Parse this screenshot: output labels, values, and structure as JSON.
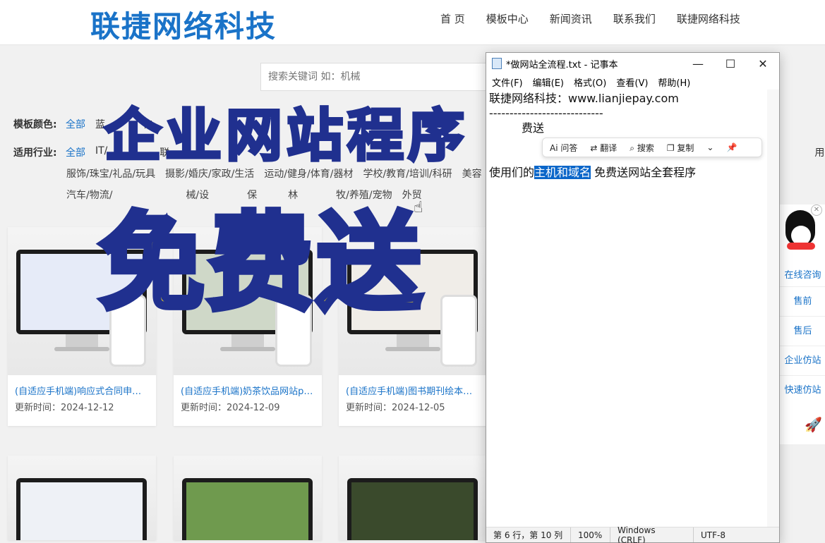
{
  "site": {
    "logo": "联捷网络科技",
    "nav": [
      "首 页",
      "模板中心",
      "新闻资讯",
      "联系我们",
      "联捷网络科技"
    ],
    "search_placeholder": "搜索关键词 如：机械"
  },
  "filters": {
    "color_label": "模板颜色:",
    "color_items": [
      "全部",
      "蓝",
      "白"
    ],
    "industry_label": "适用行业:",
    "industry_items": [
      "全部",
      "IT/",
      "联",
      "用"
    ],
    "row2": [
      "服饰/珠宝/礼品/玩具",
      "摄影/婚庆/家政/生活",
      "运动/健身/体育/器材",
      "学校/教育/培训/科研",
      "美容"
    ],
    "row3": [
      "汽车/物流/",
      "械/设",
      "保",
      "林",
      "牧/养殖/宠物",
      "外贸"
    ]
  },
  "cards": [
    {
      "title": "(自适应手机端)响应式合同申请书...",
      "date": "更新时间：2024-12-12"
    },
    {
      "title": "(自适应手机端)奶茶饮品网站pbo...",
      "date": "更新时间：2024-12-09"
    },
    {
      "title": "(自适应手机端)图书期刊绘本网站...",
      "date": "更新时间：2024-12-05"
    }
  ],
  "notepad": {
    "title": "*做网站全流程.txt - 记事本",
    "menu": [
      "文件(F)",
      "编辑(E)",
      "格式(O)",
      "查看(V)",
      "帮助(H)"
    ],
    "line1": "联捷网络科技：www.lianjiepay.com",
    "line2": "----------------------------",
    "line3": "费送",
    "line4_pre": "使用们的",
    "line4_hl": "主机和域名",
    "line4_post": " 免费送网站全套程序",
    "status": [
      "第 6 行，第 10 列",
      "100%",
      "Windows (CRLF)",
      "UTF-8"
    ]
  },
  "ai_toolbar": [
    "问答",
    "翻译",
    "搜索",
    "复制"
  ],
  "side_panel": [
    "在线咨询",
    "售前",
    "售后",
    "企业仿站",
    "快速仿站"
  ],
  "banner": {
    "line1": "企业网站程序",
    "line2": "免费送"
  }
}
